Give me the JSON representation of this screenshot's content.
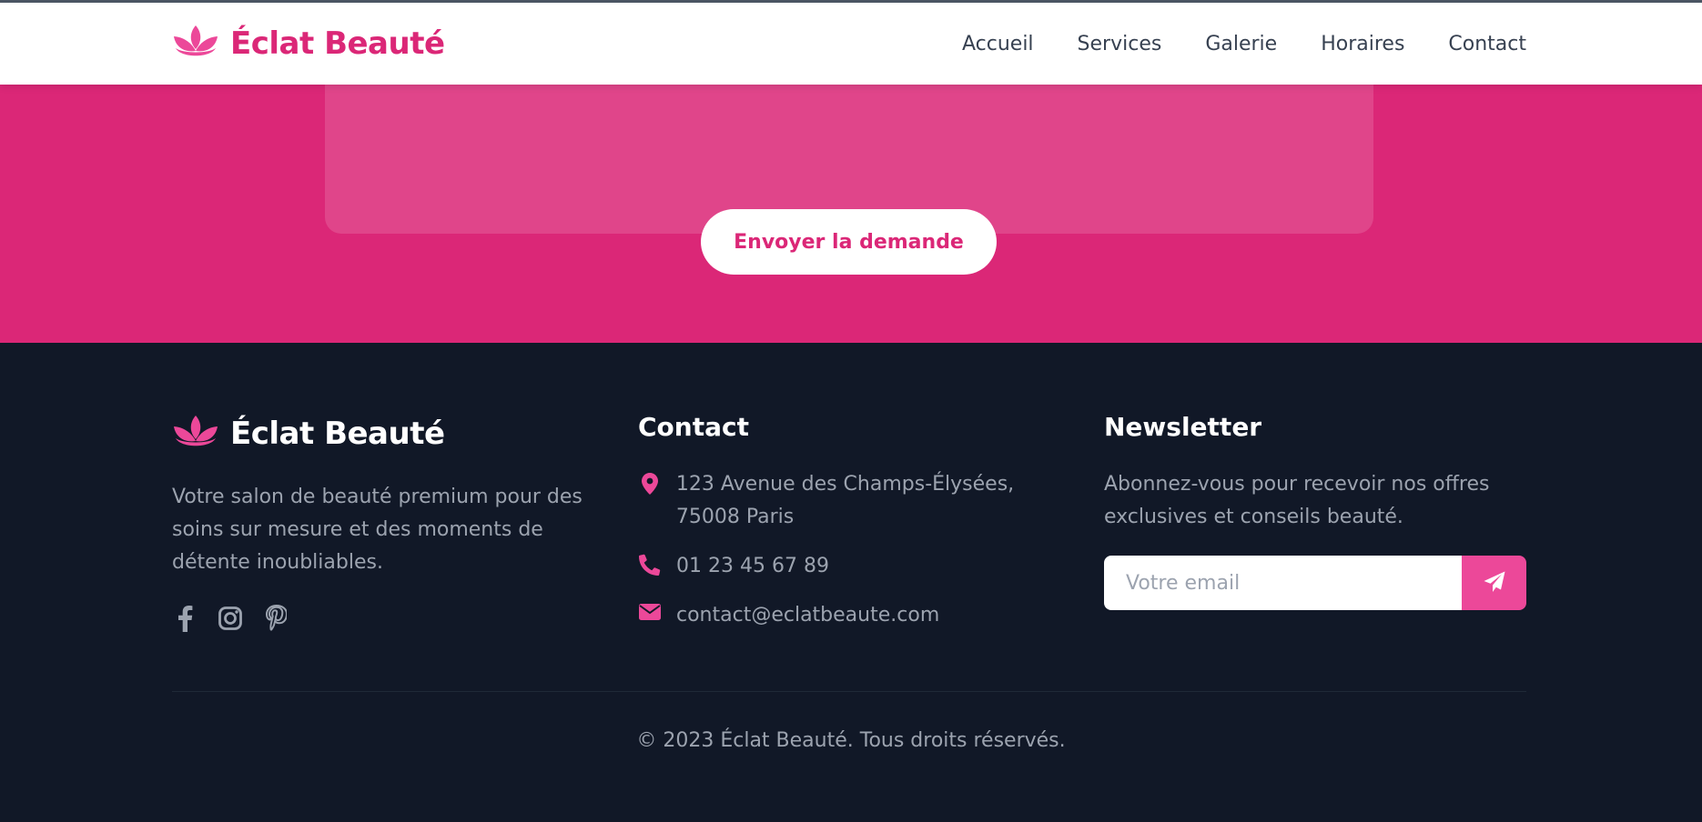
{
  "colors": {
    "brand_pink": "#db2777",
    "accent_pink": "#ec4899",
    "footer_bg": "#111827",
    "muted_text": "#9ca3af"
  },
  "header": {
    "brand_name": "Éclat Beauté",
    "logo_icon": "lotus-icon",
    "nav": [
      {
        "label": "Accueil"
      },
      {
        "label": "Services"
      },
      {
        "label": "Galerie"
      },
      {
        "label": "Horaires"
      },
      {
        "label": "Contact"
      }
    ]
  },
  "contact_form": {
    "submit_label": "Envoyer la demande"
  },
  "footer": {
    "brand_name": "Éclat Beauté",
    "description": "Votre salon de beauté premium pour des soins sur mesure et des moments de détente inoubliables.",
    "socials": [
      {
        "icon": "facebook-icon"
      },
      {
        "icon": "instagram-icon"
      },
      {
        "icon": "pinterest-icon"
      }
    ],
    "contact": {
      "title": "Contact",
      "address": "123 Avenue des Champs-Élysées, 75008 Paris",
      "phone": "01 23 45 67 89",
      "email": "contact@eclatbeaute.com"
    },
    "newsletter": {
      "title": "Newsletter",
      "description": "Abonnez-vous pour recevoir nos offres exclusives et conseils beauté.",
      "email_placeholder": "Votre email",
      "email_value": "",
      "submit_icon": "paper-plane-icon"
    },
    "copyright": "© 2023 Éclat Beauté. Tous droits réservés."
  }
}
